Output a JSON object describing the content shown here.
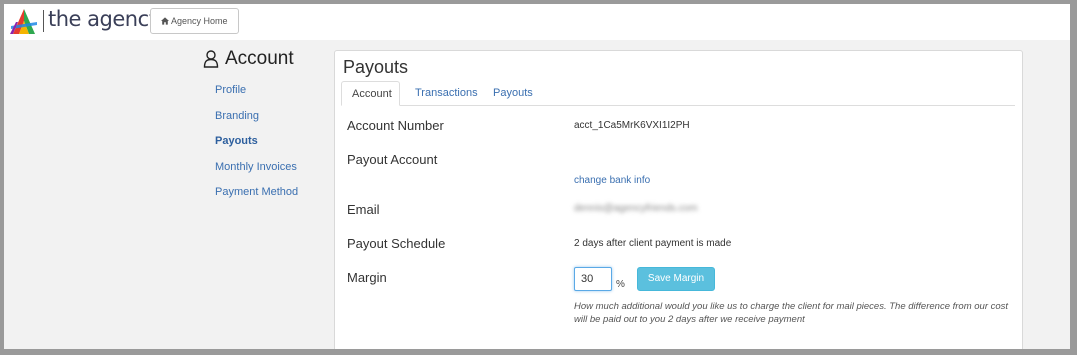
{
  "header": {
    "brand": "the agency",
    "home_button": "Agency Home"
  },
  "sidebar": {
    "title": "Account",
    "items": [
      {
        "label": "Profile"
      },
      {
        "label": "Branding"
      },
      {
        "label": "Payouts",
        "active": true
      },
      {
        "label": "Monthly Invoices"
      },
      {
        "label": "Payment Method"
      }
    ]
  },
  "main": {
    "title": "Payouts",
    "tabs": [
      {
        "label": "Account",
        "active": true
      },
      {
        "label": "Transactions"
      },
      {
        "label": "Payouts"
      }
    ],
    "account_number_label": "Account Number",
    "account_number_value": "acct_1Ca5MrK6VXI1I2PH",
    "payout_account_label": "Payout Account",
    "change_bank_link": "change bank info",
    "email_label": "Email",
    "email_value": "dennis@agencyfriends.com",
    "schedule_label": "Payout Schedule",
    "schedule_value": "2 days after client payment is made",
    "margin_label": "Margin",
    "margin_value": "30",
    "margin_unit": "%",
    "save_button": "Save Margin",
    "help_text": "How much additional would you like us to charge the client for mail pieces. The difference from our cost will be paid out to you 2 days after we receive payment"
  },
  "colors": {
    "link": "#3a6fb0",
    "save_button": "#5bc0de",
    "brand_text": "#3a3f58"
  }
}
